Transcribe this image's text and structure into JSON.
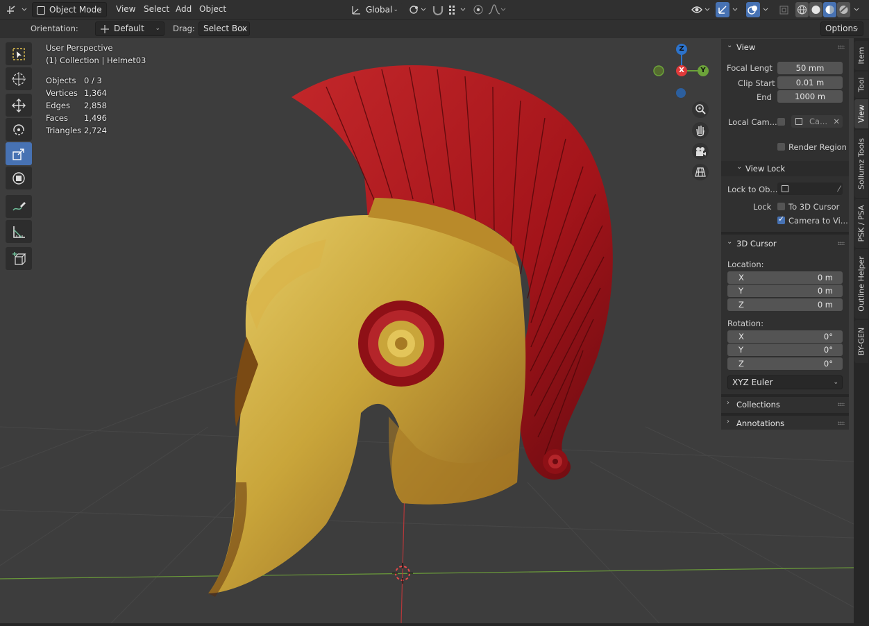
{
  "header": {
    "mode": "Object Mode",
    "menus": [
      "View",
      "Select",
      "Add",
      "Object"
    ],
    "transform_orientation": "Global"
  },
  "tool_settings": {
    "orientation_label": "Orientation:",
    "orientation_value": "Default",
    "drag_label": "Drag:",
    "drag_value": "Select Box",
    "options_label": "Options"
  },
  "overlay": {
    "view_name": "User Perspective",
    "collection": "(1) Collection | Helmet03",
    "stats": [
      {
        "label": "Objects",
        "value": "0 / 3"
      },
      {
        "label": "Vertices",
        "value": "1,364"
      },
      {
        "label": "Edges",
        "value": "2,858"
      },
      {
        "label": "Faces",
        "value": "1,496"
      },
      {
        "label": "Triangles",
        "value": "2,724"
      }
    ]
  },
  "gizmo": {
    "z": "Z",
    "x": "X",
    "y": "Y"
  },
  "npanel": {
    "view": {
      "title": "View",
      "focal_label": "Focal Lengt",
      "focal_value": "50 mm",
      "clip_start_label": "Clip Start",
      "clip_start_value": "0.01 m",
      "clip_end_label": "End",
      "clip_end_value": "1000 m",
      "local_cam_label": "Local Cam...",
      "local_cam_value": "Ca...",
      "render_region_label": "Render Region"
    },
    "view_lock": {
      "title": "View Lock",
      "lock_to_obj_label": "Lock to Ob...",
      "lock_label": "Lock",
      "to_cursor_label": "To 3D Cursor",
      "camera_to_view_label": "Camera to Vi...",
      "camera_to_view_checked": true
    },
    "cursor": {
      "title": "3D Cursor",
      "location_label": "Location:",
      "loc_x_label": "X",
      "loc_x": "0 m",
      "loc_y_label": "Y",
      "loc_y": "0 m",
      "loc_z_label": "Z",
      "loc_z": "0 m",
      "rotation_label": "Rotation:",
      "rot_x_label": "X",
      "rot_x": "0°",
      "rot_y_label": "Y",
      "rot_y": "0°",
      "rot_z_label": "Z",
      "rot_z": "0°",
      "rotation_mode": "XYZ Euler"
    },
    "collections_title": "Collections",
    "annotations_title": "Annotations"
  },
  "tabs": [
    "Item",
    "Tool",
    "View",
    "Sollumz Tools",
    "PSK / PSA",
    "Outline Helper",
    "BY-GEN"
  ],
  "active_tab": "View",
  "colors": {
    "accent": "#4772b3",
    "gizmo_x": "#e03a3a",
    "gizmo_y": "#6ca33a",
    "gizmo_z": "#2c73cc",
    "helmet_gold": "#c9a53a",
    "crest_red": "#a3141a"
  }
}
